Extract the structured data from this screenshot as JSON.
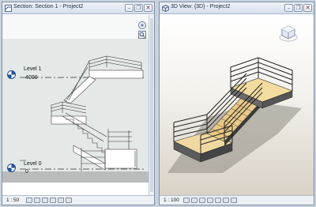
{
  "left_window": {
    "title": "Section: Section 1 - Project2",
    "scale": "1 : 50",
    "levels": [
      {
        "name": "Level 1",
        "elevation": "4000"
      },
      {
        "name": "Level 0",
        "elevation": "0"
      }
    ]
  },
  "right_window": {
    "title": "3D View: {3D} - Project2",
    "scale": "1 : 100"
  },
  "window_controls": {
    "minimize": "–",
    "restore": "❐",
    "close": "✕"
  },
  "icons": {
    "section_view": "section-view-icon",
    "3d_view": "3d-view-icon",
    "level_marker": "level-head-icon",
    "viewcube": "viewcube-icon",
    "steering_wheel": "steering-wheel-icon",
    "zoom": "zoom-icon"
  }
}
